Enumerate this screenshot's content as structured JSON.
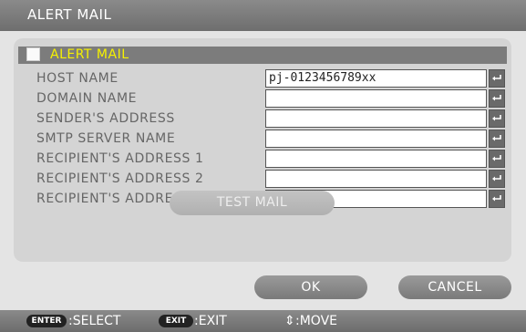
{
  "window": {
    "title": "ALERT MAIL"
  },
  "alert_mail": {
    "label": "ALERT MAIL",
    "checked": false
  },
  "fields": [
    {
      "label": "HOST NAME",
      "value": "pj-0123456789xx"
    },
    {
      "label": "DOMAIN NAME",
      "value": ""
    },
    {
      "label": "SENDER'S ADDRESS",
      "value": ""
    },
    {
      "label": "SMTP SERVER NAME",
      "value": ""
    },
    {
      "label": "RECIPIENT'S ADDRESS 1",
      "value": ""
    },
    {
      "label": "RECIPIENT'S ADDRESS 2",
      "value": ""
    },
    {
      "label": "RECIPIENT'S ADDRESS 3",
      "value": ""
    }
  ],
  "buttons": {
    "test_mail": "TEST MAIL",
    "ok": "OK",
    "cancel": "CANCEL"
  },
  "footer": {
    "enter_key": "ENTER",
    "enter_action": ":SELECT",
    "exit_key": "EXIT",
    "exit_action": ":EXIT",
    "move_glyph": "⇕",
    "move_action": ":MOVE"
  }
}
